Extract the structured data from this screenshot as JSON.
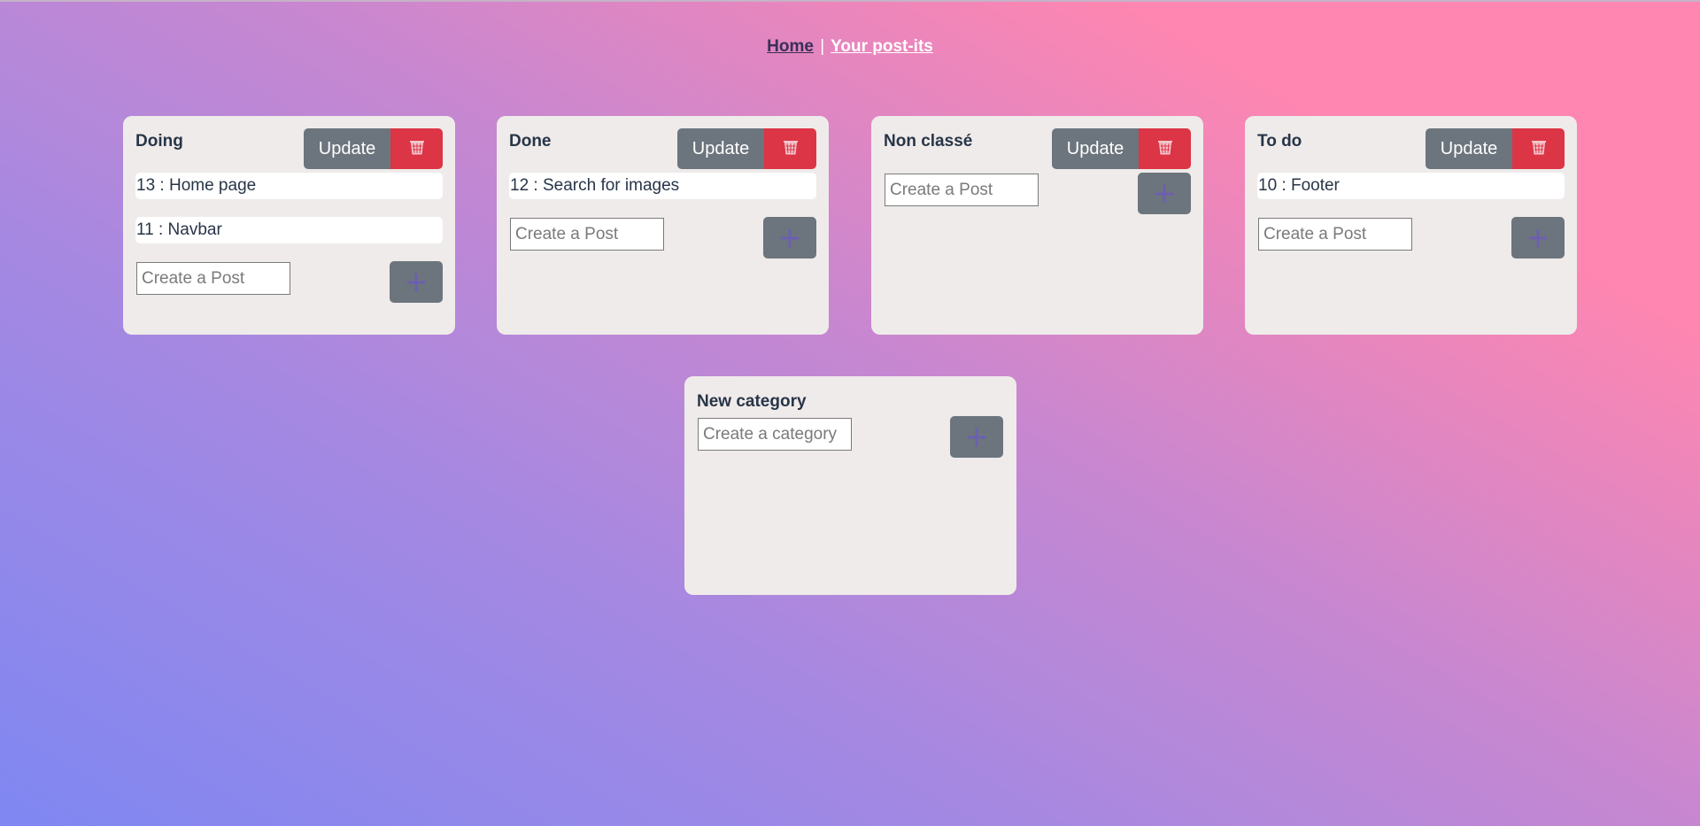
{
  "nav": {
    "home": "Home",
    "separator": "|",
    "posts": "Your post-its"
  },
  "categories": [
    {
      "title": "Doing",
      "update_label": "Update",
      "posts": [
        "13 : Home page",
        "11 : Navbar"
      ],
      "input_placeholder": "Create a Post"
    },
    {
      "title": "Done",
      "update_label": "Update",
      "posts": [
        "12 : Search for images"
      ],
      "input_placeholder": "Create a Post"
    },
    {
      "title": "Non classé",
      "update_label": "Update",
      "posts": [],
      "input_placeholder": "Create a Post"
    },
    {
      "title": "To do",
      "update_label": "Update",
      "posts": [
        "10 : Footer"
      ],
      "input_placeholder": "Create a Post"
    }
  ],
  "new_category": {
    "title": "New category",
    "input_placeholder": "Create a category"
  },
  "icons": {
    "delete": "trash-icon",
    "add": "plus-icon"
  },
  "colors": {
    "update_button": "#6c757d",
    "delete_button": "#dc3545",
    "add_icon": "#6c5fb0",
    "card_bg": "#efebea"
  }
}
